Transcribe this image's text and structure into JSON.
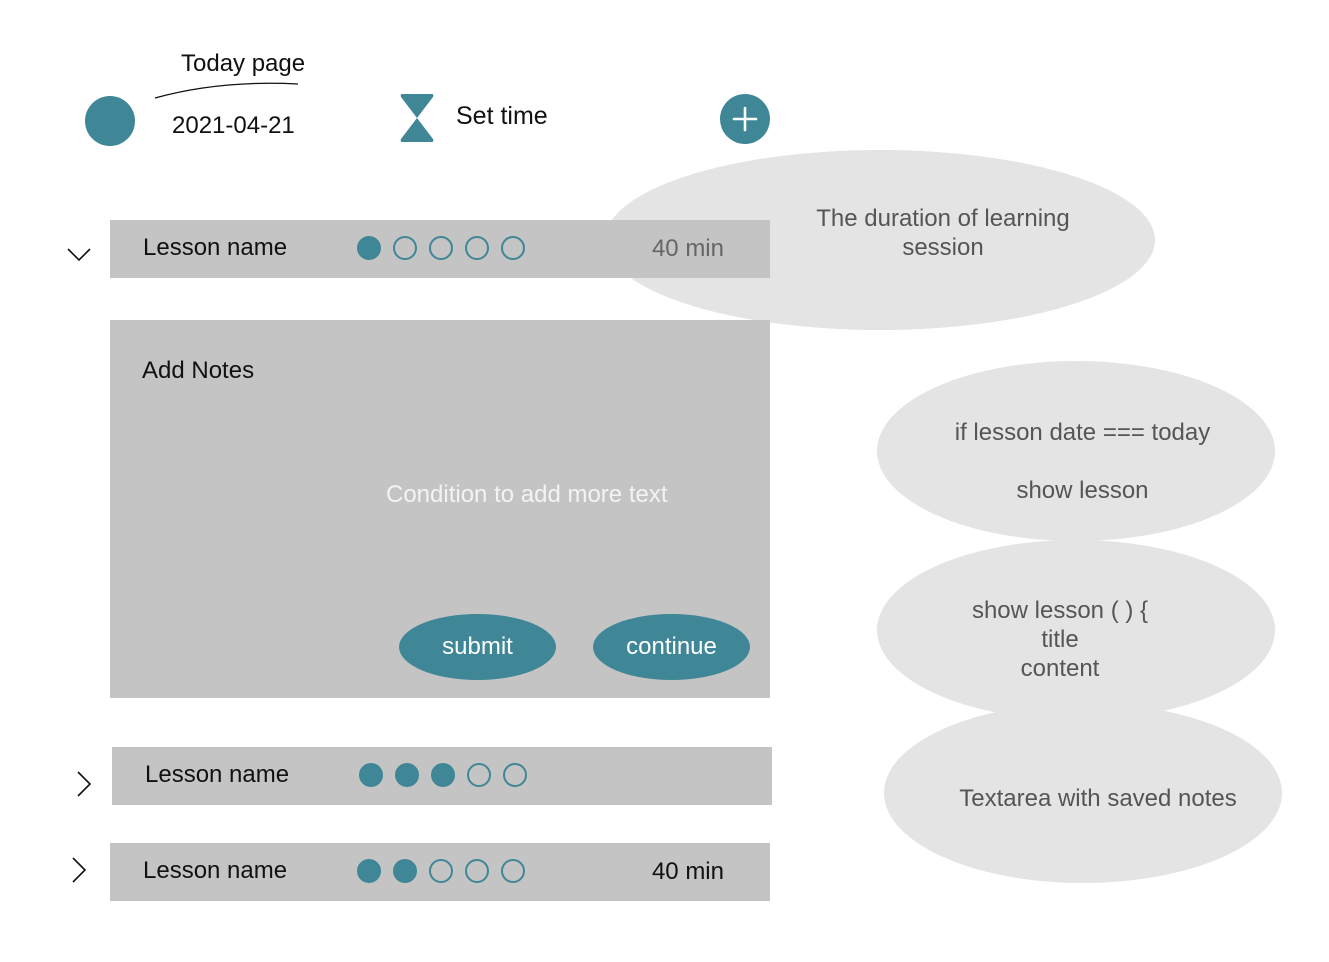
{
  "header": {
    "page_label": "Today page",
    "date": "2021-04-21",
    "set_time": "Set time",
    "accent_color": "#3f8696"
  },
  "lessons": [
    {
      "name": "Lesson name",
      "progress_filled": 1,
      "progress_total": 5,
      "duration": "40 min",
      "expanded": true
    },
    {
      "name": "Lesson name",
      "progress_filled": 3,
      "progress_total": 5,
      "duration": "",
      "expanded": false
    },
    {
      "name": "Lesson name",
      "progress_filled": 2,
      "progress_total": 5,
      "duration": "40 min",
      "expanded": false
    }
  ],
  "notes": {
    "title": "Add Notes",
    "hint": "Condition to add more text",
    "submit_label": "submit",
    "continue_label": "continue"
  },
  "annotations": {
    "duration_line1": "The duration of learning",
    "duration_line2": "session",
    "condition_line1": "if lesson date === today",
    "condition_line2": "show lesson",
    "code_line1": "show lesson ( ) {",
    "code_line2": "title",
    "code_line3": "content",
    "textarea_note": "Textarea with saved notes"
  },
  "icons": {
    "avatar": "avatar-circle",
    "timer": "hourglass-icon",
    "add": "plus-icon",
    "expanded": "chevron-down-icon",
    "collapsed": "chevron-right-icon"
  }
}
